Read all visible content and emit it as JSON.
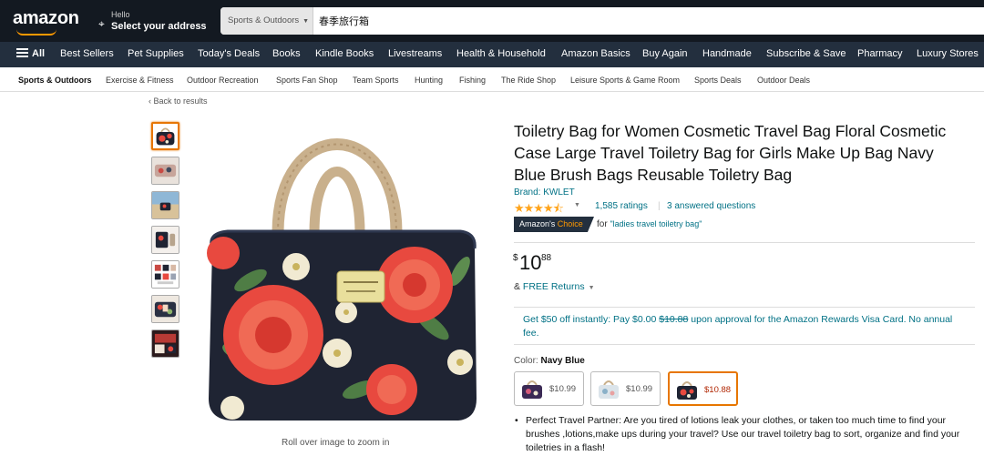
{
  "header": {
    "logo_text": "amazon",
    "hello_text": "Hello",
    "address_text": "Select your address",
    "search_category": "Sports & Outdoors",
    "search_value": "春季旅行箱"
  },
  "main_nav": {
    "all_label": "All",
    "links": [
      "Best Sellers",
      "Pet Supplies",
      "Today's Deals",
      "Books",
      "Kindle Books",
      "Livestreams",
      "Health & Household",
      "Amazon Basics",
      "Buy Again",
      "Handmade",
      "Subscribe & Save",
      "Pharmacy",
      "Luxury Stores"
    ]
  },
  "sub_nav": {
    "links": [
      "Sports & Outdoors",
      "Exercise & Fitness",
      "Outdoor Recreation",
      "Sports Fan Shop",
      "Team Sports",
      "Hunting",
      "Fishing",
      "The Ride Shop",
      "Leisure Sports & Game Room",
      "Sports Deals",
      "Outdoor Deals"
    ]
  },
  "back_link": "‹ Back to results",
  "zoom_hint": "Roll over image to zoom in",
  "product": {
    "title": "Toiletry Bag for Women Cosmetic Travel Bag Floral Cosmetic Case Large Travel Toiletry Bag for Girls Make Up Bag Navy Blue Brush Bags Reusable Toiletry Bag",
    "brand": "Brand: KWLET",
    "stars": "★★★★⯪",
    "rating_value": 4.5,
    "ratings_count": "1,585 ratings",
    "answered": "3 answered questions",
    "badge_prefix": "Amazon's ",
    "badge_highlight": "Choice",
    "badge_for": "for",
    "badge_keyword": "\"ladies travel toiletry bag\"",
    "price_symbol": "$",
    "price_whole": "10",
    "price_fraction": "88",
    "returns_prefix": "& ",
    "returns_link": "FREE Returns",
    "promo_text_1": "Get $50 off instantly: Pay $0.00 ",
    "promo_strike": "$10.88",
    "promo_text_2": " upon approval for the Amazon Rewards Visa Card. No annual fee.",
    "color_label": "Color:",
    "color_value": "Navy Blue",
    "swatches": [
      {
        "price": "$10.99",
        "palette": "purple"
      },
      {
        "price": "$10.99",
        "palette": "light"
      },
      {
        "price": "$10.88",
        "palette": "navy"
      }
    ],
    "bullet": "Perfect Travel Partner: Are you tired of lotions leak your clothes, or taken too much time to find your brushes ,lotions,make ups during your travel? Use our travel toiletry bag to sort, organize and find your toiletries in a flash!"
  },
  "colors": {
    "nav_dark": "#131921",
    "nav_mid": "#232f3e",
    "accent_orange": "#ff9900",
    "link_teal": "#007185",
    "star_gold": "#ffa41c",
    "bag_navy": "#1f2433",
    "rose_red": "#e8493f"
  }
}
